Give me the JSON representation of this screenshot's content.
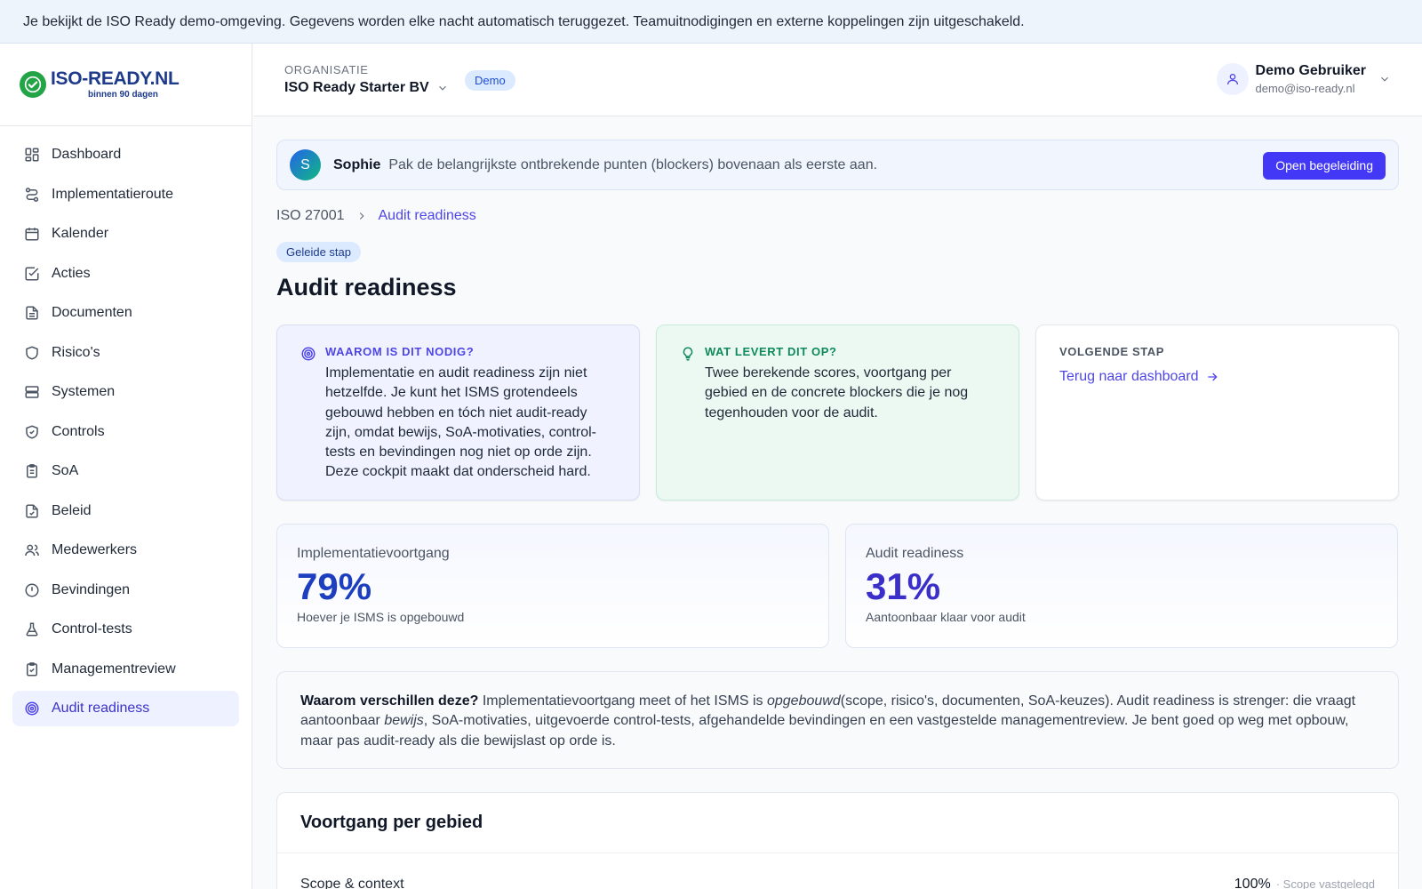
{
  "banner": {
    "text": "Je bekijkt de ISO Ready demo-omgeving. Gegevens worden elke nacht automatisch teruggezet. Teamuitnodigingen en externe koppelingen zijn uitgeschakeld."
  },
  "logo": {
    "main": "ISO-READY.NL",
    "sub": "binnen 90 dagen"
  },
  "sidebar": {
    "items": [
      {
        "label": "Dashboard",
        "icon": "dashboard-icon"
      },
      {
        "label": "Implementatieroute",
        "icon": "route-icon"
      },
      {
        "label": "Kalender",
        "icon": "calendar-icon"
      },
      {
        "label": "Acties",
        "icon": "checkbox-icon"
      },
      {
        "label": "Documenten",
        "icon": "document-icon"
      },
      {
        "label": "Risico's",
        "icon": "shield-icon"
      },
      {
        "label": "Systemen",
        "icon": "server-icon"
      },
      {
        "label": "Controls",
        "icon": "shield-check-icon"
      },
      {
        "label": "SoA",
        "icon": "clipboard-list-icon"
      },
      {
        "label": "Beleid",
        "icon": "file-check-icon"
      },
      {
        "label": "Medewerkers",
        "icon": "users-icon"
      },
      {
        "label": "Bevindingen",
        "icon": "alert-circle-icon"
      },
      {
        "label": "Control-tests",
        "icon": "flask-icon"
      },
      {
        "label": "Managementreview",
        "icon": "clipboard-check-icon"
      },
      {
        "label": "Audit readiness",
        "icon": "target-icon",
        "active": true
      }
    ]
  },
  "topbar": {
    "org_label": "ORGANISATIE",
    "org_name": "ISO Ready Starter BV",
    "badge": "Demo",
    "user_name": "Demo Gebruiker",
    "user_email": "demo@iso-ready.nl"
  },
  "coach": {
    "initial": "S",
    "name": "Sophie",
    "message": "Pak de belangrijkste ontbrekende punten (blockers) bovenaan als eerste aan.",
    "button": "Open begeleiding"
  },
  "breadcrumb": {
    "root": "ISO 27001",
    "current": "Audit readiness"
  },
  "page": {
    "badge": "Geleide stap",
    "title": "Audit readiness"
  },
  "cards": {
    "why": {
      "label": "WAAROM IS DIT NODIG?",
      "body": "Implementatie en audit readiness zijn niet hetzelfde. Je kunt het ISMS grotendeels gebouwd hebben en tóch niet audit-ready zijn, omdat bewijs, SoA-motivaties, control-tests en bevindingen nog niet op orde zijn. Deze cockpit maakt dat onderscheid hard."
    },
    "gain": {
      "label": "WAT LEVERT DIT OP?",
      "body": "Twee berekende scores, voortgang per gebied en de concrete blockers die je nog tegenhouden voor de audit."
    },
    "next": {
      "label": "VOLGENDE STAP",
      "link": "Terug naar dashboard"
    }
  },
  "stats": {
    "implementation": {
      "label": "Implementatievoortgang",
      "value": "79%",
      "sub": "Hoever je ISMS is opgebouwd"
    },
    "audit": {
      "label": "Audit readiness",
      "value": "31%",
      "sub": "Aantoonbaar klaar voor audit"
    }
  },
  "explain": {
    "q": "Waarom verschillen deze?",
    "t1": " Implementatievoortgang meet of het ISMS is ",
    "em1": "opgebouwd",
    "t2": "(scope, risico's, documenten, SoA-keuzes). Audit readiness is strenger: die vraagt aantoonbaar ",
    "em2": "bewijs",
    "t3": ", SoA-motivaties, uitgevoerde control-tests, afgehandelde bevindingen en een vastgestelde managementreview. Je bent goed op weg met opbouw, maar pas audit-ready als die bewijslast op orde is."
  },
  "progress": {
    "title": "Voortgang per gebied",
    "rows": [
      {
        "label": "Scope & context",
        "pct": "100%",
        "note": "· Scope vastgelegd"
      }
    ]
  }
}
